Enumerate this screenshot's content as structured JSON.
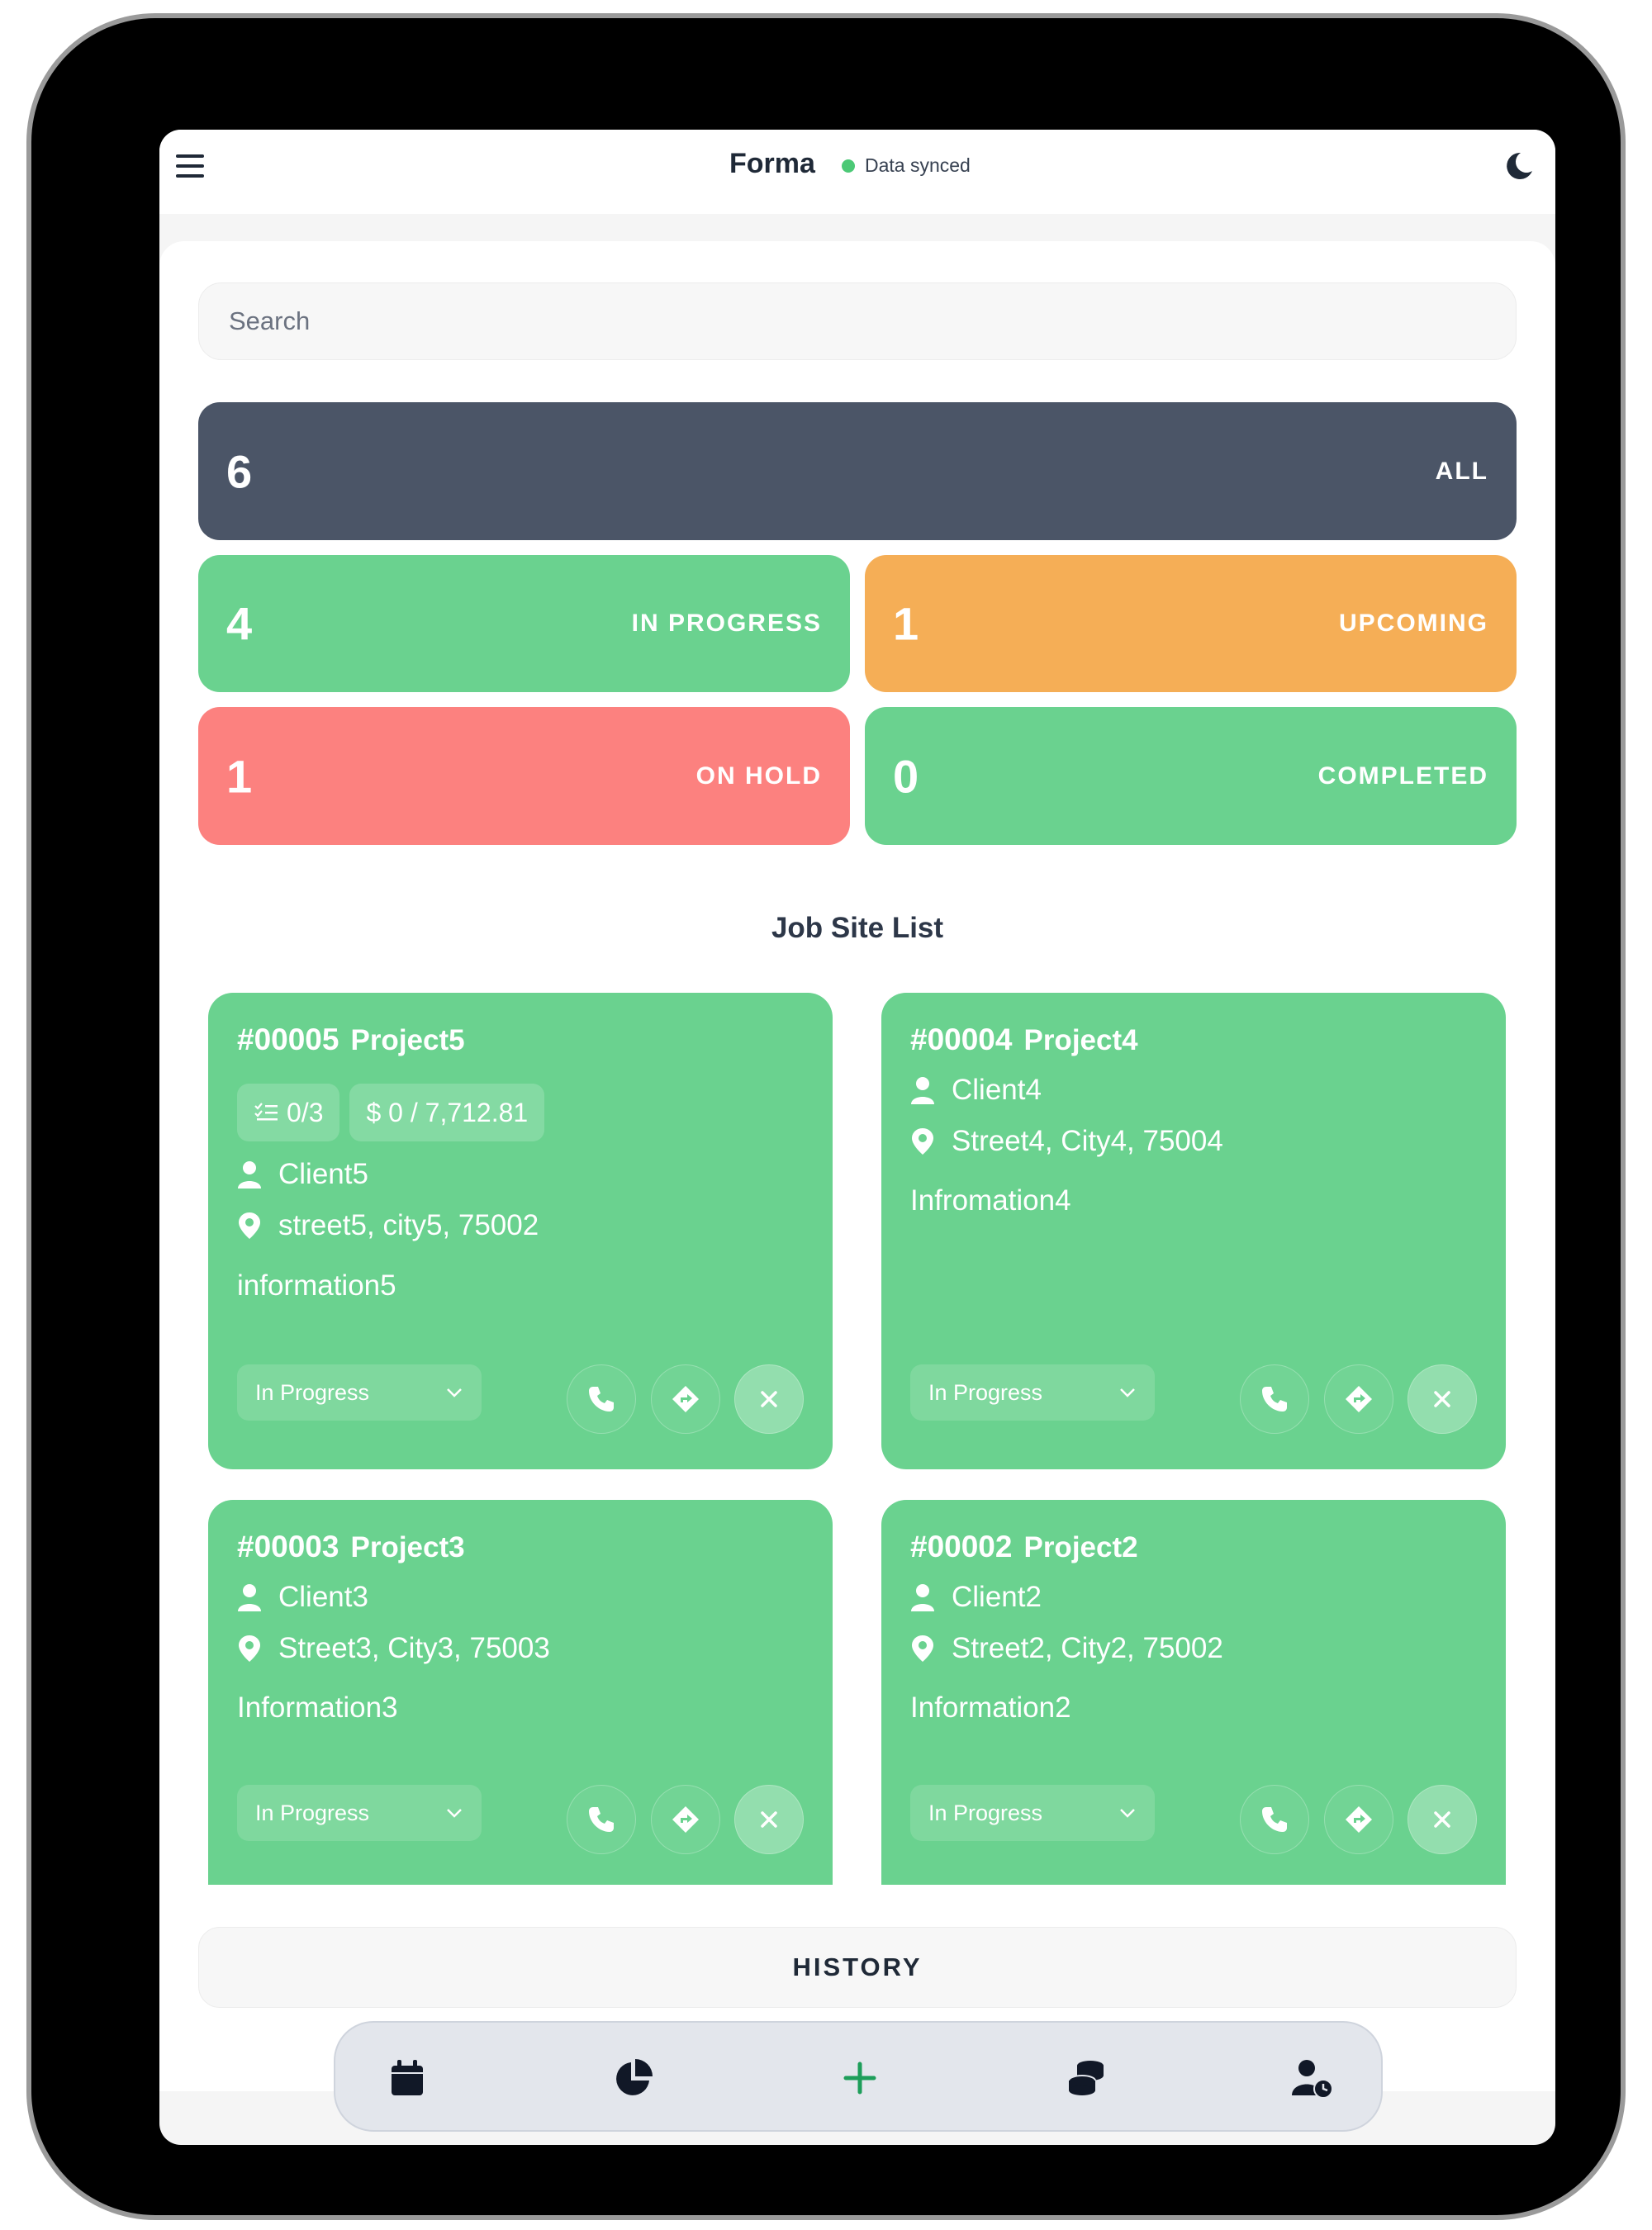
{
  "header": {
    "title": "Forma",
    "sync_status": "Data synced"
  },
  "search": {
    "placeholder": "Search"
  },
  "stats": {
    "all": {
      "count": "6",
      "label": "ALL"
    },
    "in_progress": {
      "count": "4",
      "label": "IN PROGRESS"
    },
    "upcoming": {
      "count": "1",
      "label": "UPCOMING"
    },
    "on_hold": {
      "count": "1",
      "label": "ON HOLD"
    },
    "completed": {
      "count": "0",
      "label": "COMPLETED"
    }
  },
  "job_list": {
    "title": "Job Site List",
    "cards": [
      {
        "id": "#00005",
        "name": "Project5",
        "tasks": "0/3",
        "budget": "$ 0 / 7,712.81",
        "client": "Client5",
        "address": "street5, city5, 75002",
        "info": "information5",
        "status": "In Progress"
      },
      {
        "id": "#00004",
        "name": "Project4",
        "client": "Client4",
        "address": "Street4, City4, 75004",
        "info": "Infromation4",
        "status": "In Progress"
      },
      {
        "id": "#00003",
        "name": "Project3",
        "client": "Client3",
        "address": "Street3, City3, 75003",
        "info": "Information3",
        "status": "In Progress"
      },
      {
        "id": "#00002",
        "name": "Project2",
        "client": "Client2",
        "address": "Street2, City2, 75002",
        "info": "Information2",
        "status": "In Progress"
      }
    ]
  },
  "history_label": "HISTORY",
  "bottom_nav": [
    {
      "icon": "calendar-icon"
    },
    {
      "icon": "pie-chart-icon"
    },
    {
      "icon": "plus-icon"
    },
    {
      "icon": "coins-icon"
    },
    {
      "icon": "user-clock-icon"
    }
  ],
  "colors": {
    "all": "#4b5567",
    "in_progress": "#6ad28f",
    "upcoming": "#f5ae56",
    "on_hold": "#fc817f",
    "completed": "#6ad28f",
    "sync_dot": "#4cc976",
    "accent_plus": "#1e9e5a"
  }
}
